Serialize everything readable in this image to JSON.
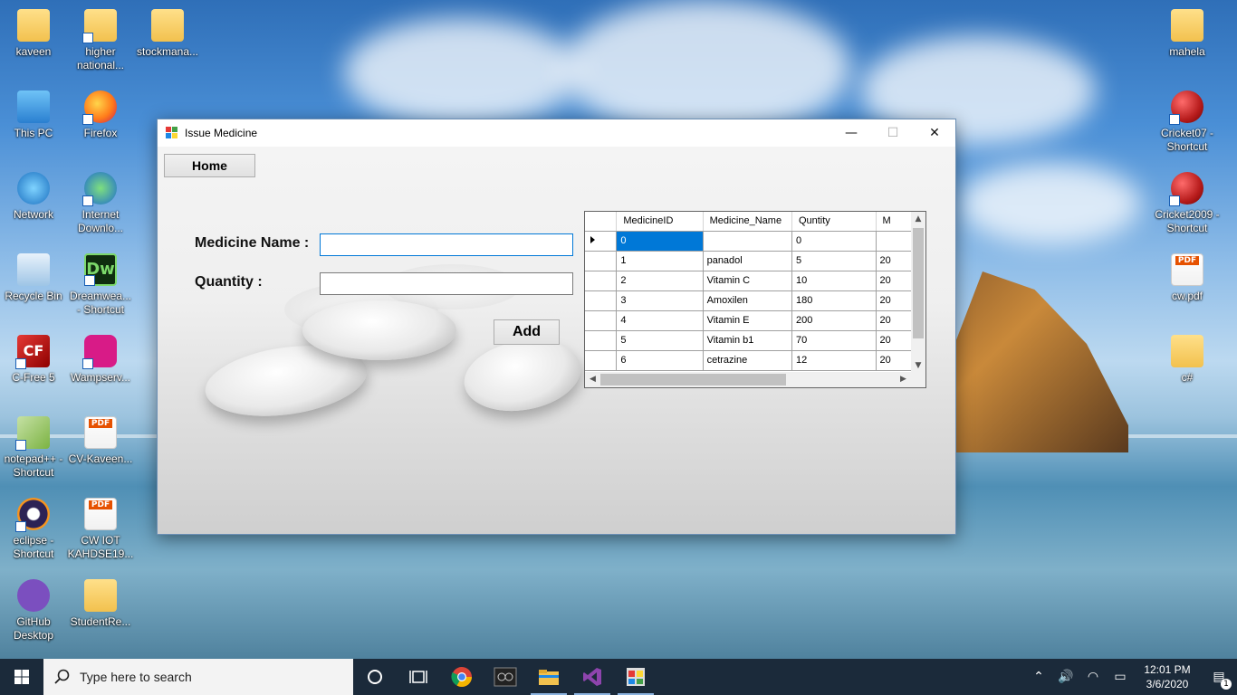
{
  "desktop": {
    "icons_left": [
      {
        "label": "kaveen",
        "kind": "folder"
      },
      {
        "label": "higher\nnational...",
        "kind": "doc"
      },
      {
        "label": "stockmana...",
        "kind": "folder-vs"
      },
      {
        "label": "This PC",
        "kind": "pc"
      },
      {
        "label": "Firefox",
        "kind": "firefox"
      },
      {
        "label": "Network",
        "kind": "network"
      },
      {
        "label": "Internet\nDownlo...",
        "kind": "idm"
      },
      {
        "label": "Recycle Bin",
        "kind": "bin"
      },
      {
        "label": "Dreamwea...\n- Shortcut",
        "kind": "dw",
        "glyph": "Dw"
      },
      {
        "label": "C-Free 5",
        "kind": "cfree",
        "glyph": "CF"
      },
      {
        "label": "Wampserv...",
        "kind": "wamp"
      },
      {
        "label": "notepad++ -\nShortcut",
        "kind": "npp"
      },
      {
        "label": "CV-Kaveen...",
        "kind": "pdf"
      },
      {
        "label": "eclipse -\nShortcut",
        "kind": "eclipse"
      },
      {
        "label": "CW IOT\nKAHDSE19...",
        "kind": "pdf"
      },
      {
        "label": "GitHub\nDesktop",
        "kind": "github"
      },
      {
        "label": "StudentRe...",
        "kind": "folder"
      }
    ],
    "icons_right": [
      {
        "label": "mahela",
        "kind": "folder"
      },
      {
        "label": "Cricket07 -\nShortcut",
        "kind": "cricket"
      },
      {
        "label": "Cricket2009 -\nShortcut",
        "kind": "cricket"
      },
      {
        "label": "cw.pdf",
        "kind": "pdf"
      },
      {
        "label": "c#",
        "kind": "folder"
      }
    ],
    "pdf_badge": "PDF"
  },
  "window": {
    "title": "Issue Medicine",
    "controls": {
      "minimize": "—",
      "maximize": "☐",
      "close": "✕"
    },
    "home_button": "Home",
    "medicine_name_label": "Medicine Name :",
    "quantity_label": "Quantity :",
    "medicine_name_value": "",
    "quantity_value": "",
    "add_button": "Add"
  },
  "grid": {
    "columns": [
      "MedicineID",
      "Medicine_Name",
      "Quntity",
      "M"
    ],
    "rows": [
      {
        "id": "0",
        "name": "",
        "qty": "0",
        "m": ""
      },
      {
        "id": "1",
        "name": "panadol",
        "qty": "5",
        "m": "20"
      },
      {
        "id": "2",
        "name": "Vitamin C",
        "qty": "10",
        "m": "20"
      },
      {
        "id": "3",
        "name": "Amoxilen",
        "qty": "180",
        "m": "20"
      },
      {
        "id": "4",
        "name": "Vitamin E",
        "qty": "200",
        "m": "20"
      },
      {
        "id": "5",
        "name": "Vitamin b1",
        "qty": "70",
        "m": "20"
      },
      {
        "id": "6",
        "name": "cetrazine",
        "qty": "12",
        "m": "20"
      }
    ]
  },
  "taskbar": {
    "search_placeholder": "Type here to search",
    "time": "12:01 PM",
    "date": "3/6/2020",
    "notification_count": "1"
  }
}
